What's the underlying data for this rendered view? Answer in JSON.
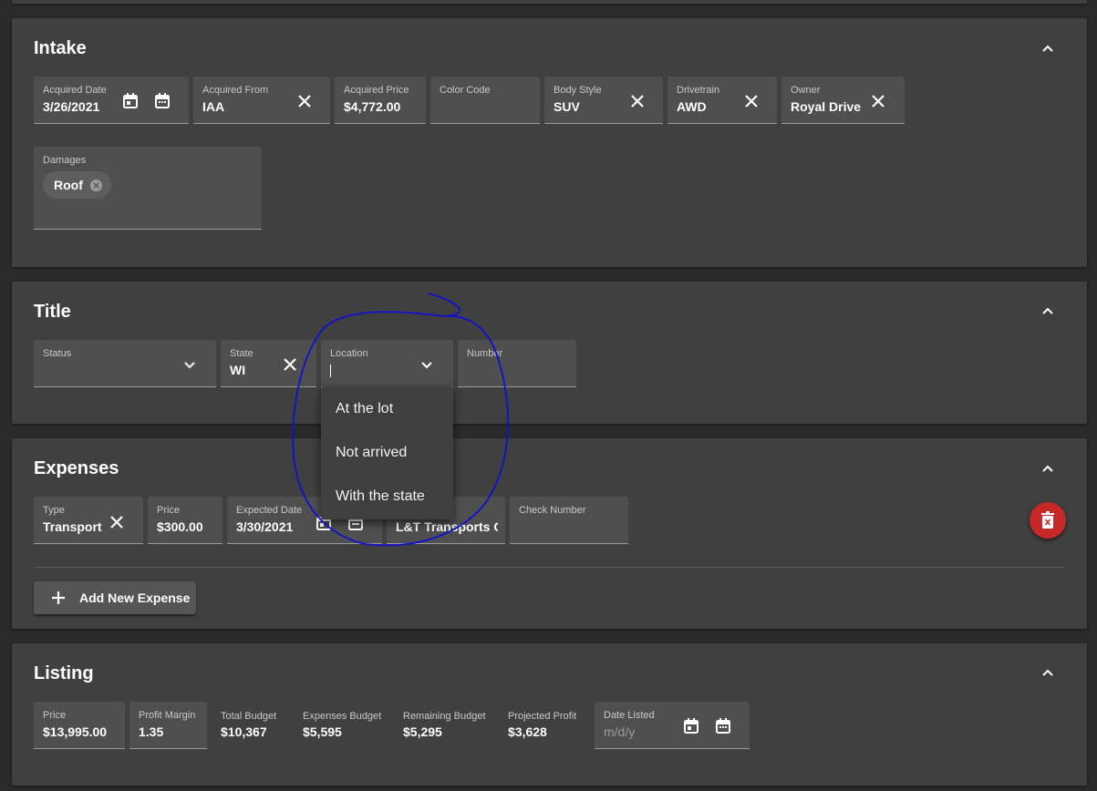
{
  "intake": {
    "title": "Intake",
    "fields": {
      "acquired_date": {
        "label": "Acquired Date",
        "value": "3/26/2021"
      },
      "acquired_from": {
        "label": "Acquired From",
        "value": "IAA"
      },
      "acquired_price": {
        "label": "Acquired Price",
        "value": "$4,772.00"
      },
      "color_code": {
        "label": "Color Code",
        "value": ""
      },
      "body_style": {
        "label": "Body Style",
        "value": "SUV"
      },
      "drivetrain": {
        "label": "Drivetrain",
        "value": "AWD"
      },
      "owner": {
        "label": "Owner",
        "value": "Royal Drive"
      }
    },
    "damages": {
      "label": "Damages",
      "chips": [
        "Roof"
      ]
    }
  },
  "title_section": {
    "title": "Title",
    "fields": {
      "status": {
        "label": "Status",
        "value": ""
      },
      "state": {
        "label": "State",
        "value": "WI"
      },
      "location": {
        "label": "Location",
        "value": ""
      },
      "number": {
        "label": "Number",
        "value": ""
      }
    },
    "location_options": [
      "At the lot",
      "Not arrived",
      "With the state"
    ]
  },
  "expenses": {
    "title": "Expenses",
    "row": {
      "type": {
        "label": "Type",
        "value": "Transport"
      },
      "price": {
        "label": "Price",
        "value": "$300.00"
      },
      "expected_date": {
        "label": "Expected Date",
        "value": "3/30/2021"
      },
      "vendor": {
        "label": "",
        "value": "L&T Transports Co"
      },
      "check_number": {
        "label": "Check Number",
        "value": ""
      }
    },
    "add_button": "Add New Expense"
  },
  "listing": {
    "title": "Listing",
    "fields": {
      "price": {
        "label": "Price",
        "value": "$13,995.00"
      },
      "profit_margin": {
        "label": "Profit Margin",
        "value": "1.35"
      },
      "date_listed": {
        "label": "Date Listed",
        "placeholder": "m/d/y"
      }
    },
    "stats": {
      "total_budget": {
        "label": "Total Budget",
        "value": "$10,367"
      },
      "expenses_budget": {
        "label": "Expenses Budget",
        "value": "$5,595"
      },
      "remaining_budget": {
        "label": "Remaining Budget",
        "value": "$5,295"
      },
      "projected_profit": {
        "label": "Projected Profit",
        "value": "$3,628"
      }
    }
  },
  "colors": {
    "background": "#2b2b2b",
    "panel": "#404040",
    "field": "#4f4f4f",
    "danger": "#c62828",
    "annotation": "#1010d0"
  }
}
